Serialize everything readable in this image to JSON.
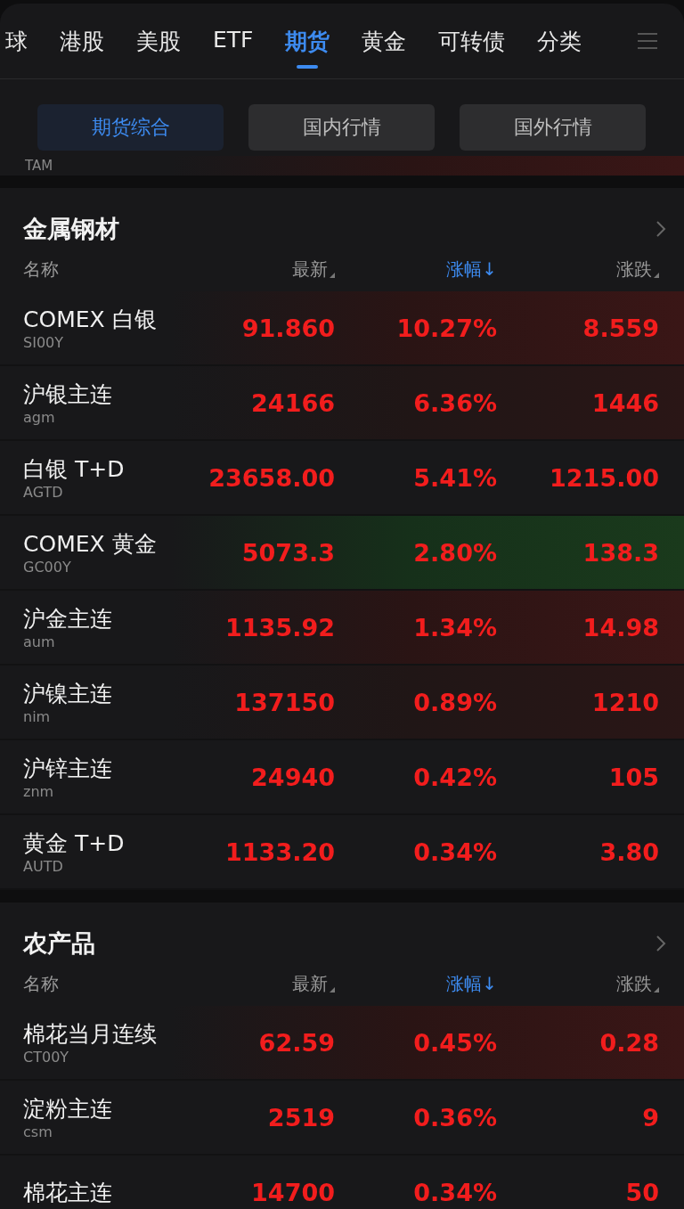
{
  "tabs": [
    {
      "label": "球",
      "selected": false
    },
    {
      "label": "港股",
      "selected": false
    },
    {
      "label": "美股",
      "selected": false
    },
    {
      "label": "ETF",
      "selected": false
    },
    {
      "label": "期货",
      "selected": true
    },
    {
      "label": "黄金",
      "selected": false
    },
    {
      "label": "可转债",
      "selected": false
    },
    {
      "label": "分类",
      "selected": false
    }
  ],
  "subtabs": [
    {
      "label": "期货综合",
      "selected": true
    },
    {
      "label": "国内行情",
      "selected": false
    },
    {
      "label": "国外行情",
      "selected": false
    }
  ],
  "partial_row": {
    "code": "TAM",
    "kind": "up"
  },
  "sections": [
    {
      "title": "金属钢材",
      "columns": [
        {
          "label": "名称",
          "active": false,
          "sortable": false
        },
        {
          "label": "最新",
          "active": false,
          "sortable": true
        },
        {
          "label": "涨幅",
          "active": true,
          "sortable": false,
          "arrow": "↓"
        },
        {
          "label": "涨跌",
          "active": false,
          "sortable": true
        }
      ],
      "rows": [
        {
          "name": "COMEX 白银",
          "code": "SI00Y",
          "latest": "91.860",
          "pct": "10.27%",
          "change": "8.559",
          "kind": "up"
        },
        {
          "name": "沪银主连",
          "code": "agm",
          "latest": "24166",
          "pct": "6.36%",
          "change": "1446",
          "kind": "weak"
        },
        {
          "name": "白银 T+D",
          "code": "AGTD",
          "latest": "23658.00",
          "pct": "5.41%",
          "change": "1215.00",
          "kind": "plain"
        },
        {
          "name": "COMEX 黄金",
          "code": "GC00Y",
          "latest": "5073.3",
          "pct": "2.80%",
          "change": "138.3",
          "kind": "green"
        },
        {
          "name": "沪金主连",
          "code": "aum",
          "latest": "1135.92",
          "pct": "1.34%",
          "change": "14.98",
          "kind": "up"
        },
        {
          "name": "沪镍主连",
          "code": "nim",
          "latest": "137150",
          "pct": "0.89%",
          "change": "1210",
          "kind": "weak"
        },
        {
          "name": "沪锌主连",
          "code": "znm",
          "latest": "24940",
          "pct": "0.42%",
          "change": "105",
          "kind": "plain"
        },
        {
          "name": "黄金 T+D",
          "code": "AUTD",
          "latest": "1133.20",
          "pct": "0.34%",
          "change": "3.80",
          "kind": "plain"
        }
      ]
    },
    {
      "title": "农产品",
      "columns": [
        {
          "label": "名称",
          "active": false,
          "sortable": false
        },
        {
          "label": "最新",
          "active": false,
          "sortable": true
        },
        {
          "label": "涨幅",
          "active": true,
          "sortable": false,
          "arrow": "↓"
        },
        {
          "label": "涨跌",
          "active": false,
          "sortable": true
        }
      ],
      "rows": [
        {
          "name": "棉花当月连续",
          "code": "CT00Y",
          "latest": "62.59",
          "pct": "0.45%",
          "change": "0.28",
          "kind": "up"
        },
        {
          "name": "淀粉主连",
          "code": "csm",
          "latest": "2519",
          "pct": "0.36%",
          "change": "9",
          "kind": "plain"
        },
        {
          "name": "棉花主连",
          "latest": "14700",
          "pct": "0.34%",
          "change": "50",
          "kind": "plain"
        }
      ]
    }
  ]
}
